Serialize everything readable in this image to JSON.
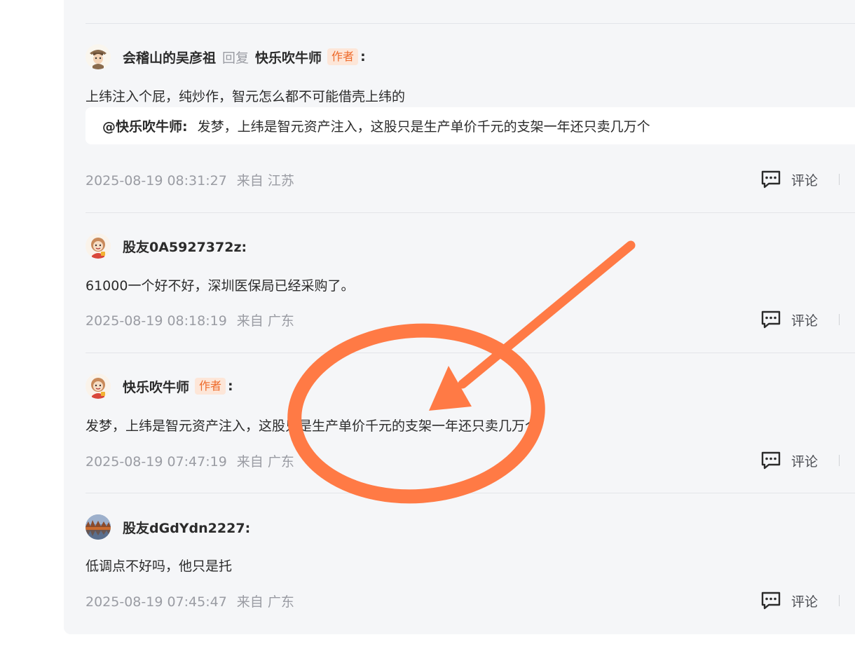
{
  "labels": {
    "reply_word": "回复",
    "author_tag": "作者",
    "colon": ":",
    "comment_action": "评论",
    "from_prefix": "来自"
  },
  "comments": [
    {
      "username": "会稽山的吴彦祖",
      "reply_to": "快乐吹牛师",
      "text": "上纬注入个屁，纯炒作，智元怎么都不可能借壳上纬的",
      "quote": {
        "user": "@快乐吹牛师:",
        "text": "发梦，上纬是智元资产注入，这股只是生产单价千元的支架一年还只卖几万个"
      },
      "time": "2025-08-19 08:31:27",
      "from_prefix": "来自",
      "region": "江苏"
    },
    {
      "username": "股友0A5927372z:",
      "text": "61000一个好不好，深圳医保局已经采购了。",
      "time": "2025-08-19 08:18:19",
      "from_prefix": "来自",
      "region": "广东"
    },
    {
      "username": "快乐吹牛师",
      "text": "发梦，上纬是智元资产注入，这股只是生产单价千元的支架一年还只卖几万个",
      "time": "2025-08-19 07:47:19",
      "from_prefix": "来自",
      "region": "广东"
    },
    {
      "username": "股友dGdYdn2227:",
      "text": "低调点不好吗，他只是托",
      "time": "2025-08-19 07:45:47",
      "from_prefix": "来自",
      "region": "广东"
    }
  ],
  "colors": {
    "accent_orange": "#ff7a45",
    "author_tag_text": "#ee6a2a",
    "author_tag_bg": "#fde6d8",
    "panel_bg": "#f5f6f8"
  },
  "annotation": {
    "shape": "hand-drawn circle and arrow",
    "color": "#ff7a45"
  }
}
